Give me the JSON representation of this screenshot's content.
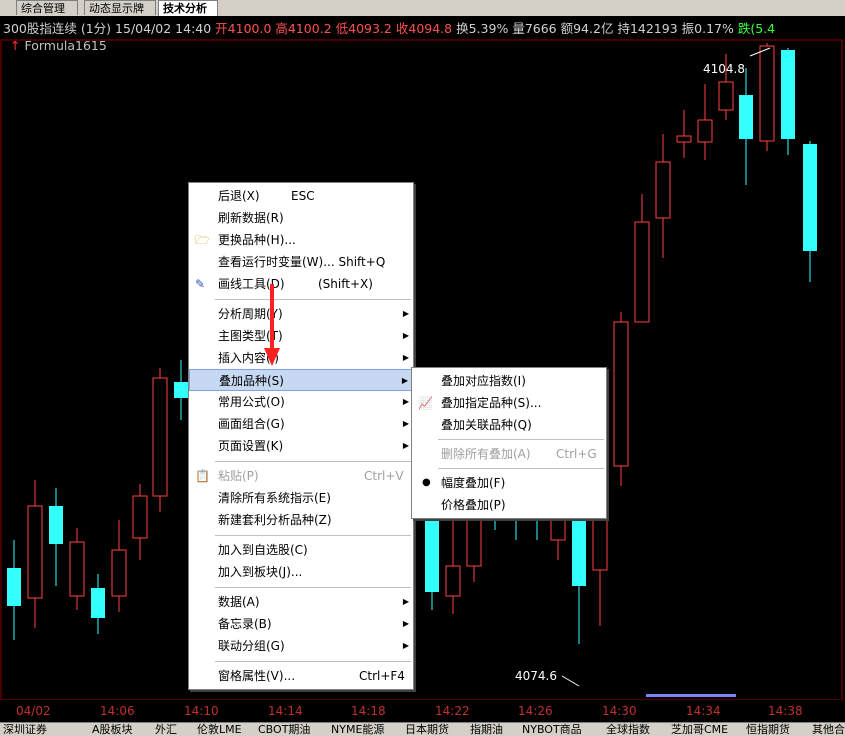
{
  "tabs": [
    {
      "label": "综合管理",
      "active": false
    },
    {
      "label": "动态显示牌",
      "active": false
    },
    {
      "label": "技术分析",
      "active": true
    }
  ],
  "info": {
    "name": "300股指连续",
    "period": "(1分)",
    "datetime": "15/04/02 14:40",
    "open": "开4100.0",
    "high": "高4100.2",
    "low": "低4093.2",
    "close": "收4094.8",
    "turnover": "换5.39%",
    "volume": "量7666",
    "amount": "额94.2亿",
    "position": "持142193",
    "amplitude": "振0.17%",
    "change": "跌(5.4"
  },
  "formula": "Formula1615",
  "price_labels": {
    "high": "4104.8",
    "low": "4074.6"
  },
  "colors": {
    "up": "#ff4040",
    "down": "#33ffff",
    "grid": "#8b0000",
    "menu_highlight": "#c7d9f2"
  },
  "time_axis": [
    "04/02",
    "14:06",
    "14:10",
    "14:14",
    "14:18",
    "14:22",
    "14:26",
    "14:30",
    "14:34",
    "14:38"
  ],
  "bottom_tabs": [
    "深圳证券",
    "A股板块",
    "外汇",
    "伦敦LME",
    "CBOT期油",
    "NYME能源",
    "日本期货",
    "指期油",
    "NYBOT商品",
    "全球指数",
    "芝加哥CME",
    "恒指期货",
    "其他合"
  ],
  "context_menu": {
    "items": [
      {
        "label": "后退(X)",
        "shortcut": "ESC",
        "icon": "",
        "disabled": false,
        "submenu": false
      },
      {
        "label": "刷新数据(R)",
        "shortcut": "",
        "icon": "",
        "disabled": false,
        "submenu": false
      },
      {
        "label": "更换品种(H)...",
        "shortcut": "",
        "icon": "folder-icon",
        "disabled": false,
        "submenu": false
      },
      {
        "label": "查看运行时变量(W)... Shift+Q",
        "shortcut": "",
        "icon": "",
        "disabled": false,
        "submenu": false
      },
      {
        "label": "画线工具(D)",
        "shortcut": "(Shift+X)",
        "icon": "pencil-icon",
        "disabled": false,
        "submenu": false
      },
      {
        "label": "分析周期(Y)",
        "shortcut": "",
        "icon": "",
        "disabled": false,
        "submenu": true
      },
      {
        "label": "主图类型(T)",
        "shortcut": "",
        "icon": "",
        "disabled": false,
        "submenu": true
      },
      {
        "label": "插入内容(I)",
        "shortcut": "",
        "icon": "",
        "disabled": false,
        "submenu": true
      },
      {
        "label": "叠加品种(S)",
        "shortcut": "",
        "icon": "",
        "disabled": false,
        "submenu": true,
        "highlighted": true
      },
      {
        "label": "常用公式(O)",
        "shortcut": "",
        "icon": "",
        "disabled": false,
        "submenu": true
      },
      {
        "label": "画面组合(G)",
        "shortcut": "",
        "icon": "",
        "disabled": false,
        "submenu": true
      },
      {
        "label": "页面设置(K)",
        "shortcut": "",
        "icon": "",
        "disabled": false,
        "submenu": true
      },
      {
        "label": "粘贴(P)",
        "shortcut": "Ctrl+V",
        "icon": "clipboard-icon",
        "disabled": true,
        "submenu": false
      },
      {
        "label": "清除所有系统指示(E)",
        "shortcut": "",
        "icon": "",
        "disabled": false,
        "submenu": false
      },
      {
        "label": "新建套利分析品种(Z)",
        "shortcut": "",
        "icon": "",
        "disabled": false,
        "submenu": false
      },
      {
        "label": "加入到自选股(C)",
        "shortcut": "",
        "icon": "",
        "disabled": false,
        "submenu": false
      },
      {
        "label": "加入到板块(J)...",
        "shortcut": "",
        "icon": "",
        "disabled": false,
        "submenu": false
      },
      {
        "label": "数据(A)",
        "shortcut": "",
        "icon": "",
        "disabled": false,
        "submenu": true
      },
      {
        "label": "备忘录(B)",
        "shortcut": "",
        "icon": "",
        "disabled": false,
        "submenu": true
      },
      {
        "label": "联动分组(G)",
        "shortcut": "",
        "icon": "",
        "disabled": false,
        "submenu": true
      },
      {
        "label": "窗格属性(V)...",
        "shortcut": "Ctrl+F4",
        "icon": "",
        "disabled": false,
        "submenu": false
      }
    ]
  },
  "submenu": {
    "items": [
      {
        "label": "叠加对应指数(I)",
        "shortcut": "",
        "disabled": false,
        "icon": ""
      },
      {
        "label": "叠加指定品种(S)...",
        "shortcut": "",
        "disabled": false,
        "icon": "chart-icon"
      },
      {
        "label": "叠加关联品种(Q)",
        "shortcut": "",
        "disabled": false,
        "icon": ""
      },
      {
        "label": "删除所有叠加(A)",
        "shortcut": "Ctrl+G",
        "disabled": true,
        "icon": ""
      },
      {
        "label": "幅度叠加(F)",
        "shortcut": "",
        "disabled": false,
        "icon": "radio-dot-icon"
      },
      {
        "label": "价格叠加(P)",
        "shortcut": "",
        "disabled": false,
        "icon": ""
      }
    ]
  }
}
